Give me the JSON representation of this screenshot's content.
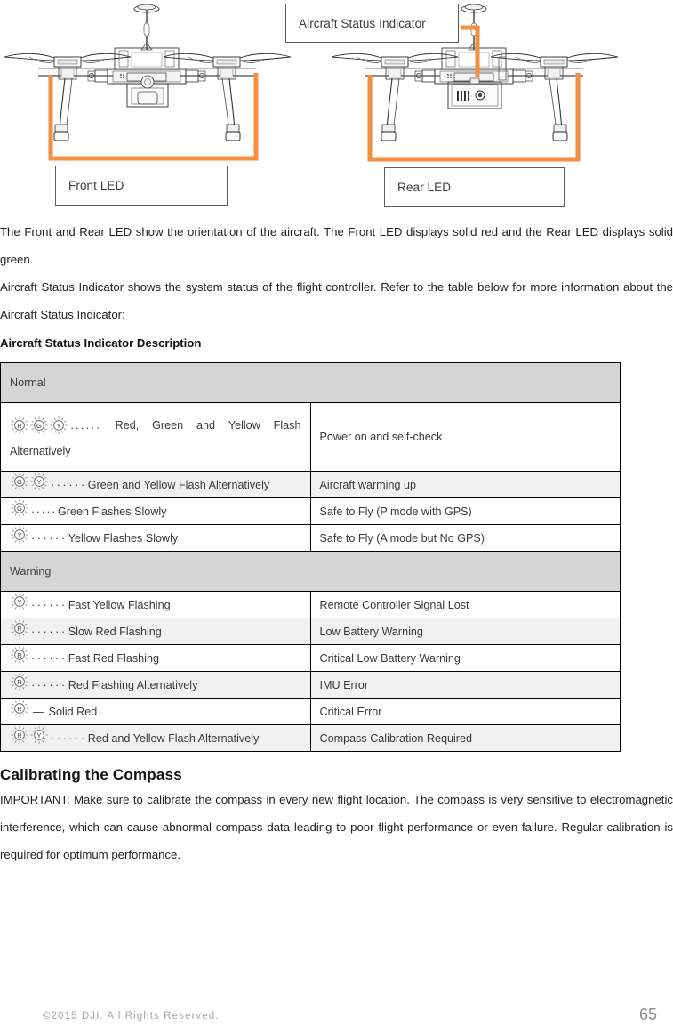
{
  "figure": {
    "callouts": {
      "status_indicator": "Aircraft Status Indicator",
      "front_led": "Front LED",
      "rear_led": "Rear LED"
    },
    "accent_color": "#F58E3E"
  },
  "body": {
    "para1": "The Front and Rear LED show the orientation of the aircraft. The Front LED displays solid red and the Rear LED displays solid green.",
    "para2": "Aircraft Status Indicator shows the system status of the flight controller. Refer to the table below for more information about the Aircraft Status Indicator:",
    "table_heading": "Aircraft Status Indicator Description"
  },
  "table": {
    "sections": [
      {
        "label": "Normal"
      },
      {
        "label": "Warning"
      }
    ],
    "rows": [
      {
        "group": "Normal",
        "icons": [
          "R",
          "G",
          "Y"
        ],
        "dots": "......",
        "pattern_words": [
          "Red,",
          "Green",
          "and",
          "Yellow",
          "Flash"
        ],
        "pattern_second_line": "Alternatively",
        "pattern": "Red, Green and Yellow Flash Alternatively",
        "description": "Power on and self-check",
        "shaded": false
      },
      {
        "group": "Normal",
        "icons": [
          "G",
          "Y"
        ],
        "dots": "......",
        "pattern": "Green and Yellow Flash Alternatively",
        "description": "Aircraft warming up",
        "shaded": true
      },
      {
        "group": "Normal",
        "icons": [
          "G"
        ],
        "dots": ".....",
        "pattern": "Green Flashes Slowly",
        "description": "Safe to Fly (P mode with GPS)",
        "shaded": false
      },
      {
        "group": "Normal",
        "icons": [
          "Y"
        ],
        "dots": "......",
        "pattern": "Yellow Flashes Slowly",
        "description": "Safe to Fly (A mode but No GPS)",
        "shaded": false
      },
      {
        "group": "Warning",
        "icons": [
          "Y"
        ],
        "dots": "......",
        "pattern": "Fast Yellow Flashing",
        "description": "Remote Controller Signal Lost",
        "shaded": false
      },
      {
        "group": "Warning",
        "icons": [
          "R"
        ],
        "dots": "......",
        "pattern": "Slow Red Flashing",
        "description": "Low Battery Warning",
        "shaded": true
      },
      {
        "group": "Warning",
        "icons": [
          "R"
        ],
        "dots": "......",
        "pattern": "Fast Red Flashing",
        "description": "Critical Low Battery Warning",
        "shaded": false
      },
      {
        "group": "Warning",
        "icons": [
          "R"
        ],
        "dots": "......",
        "pattern": "Red Flashing Alternatively",
        "description": "IMU Error",
        "shaded": true
      },
      {
        "group": "Warning",
        "icons": [
          "R"
        ],
        "dots": "—",
        "pattern": "Solid Red",
        "description": "Critical Error",
        "shaded": false
      },
      {
        "group": "Warning",
        "icons": [
          "R",
          "Y"
        ],
        "dots": "......",
        "pattern": "Red and Yellow Flash Alternatively",
        "description": "Compass Calibration Required",
        "shaded": true
      }
    ]
  },
  "compass": {
    "title": "Calibrating the Compass",
    "text": "IMPORTANT: Make sure to calibrate the compass in every new flight location. The compass is very sensitive to electromagnetic interference, which can cause abnormal compass data leading to poor flight performance or even failure. Regular calibration is required for optimum performance."
  },
  "footer": {
    "copyright": "©2015  DJI.  All  Rights  Reserved.",
    "page_number": "65"
  }
}
